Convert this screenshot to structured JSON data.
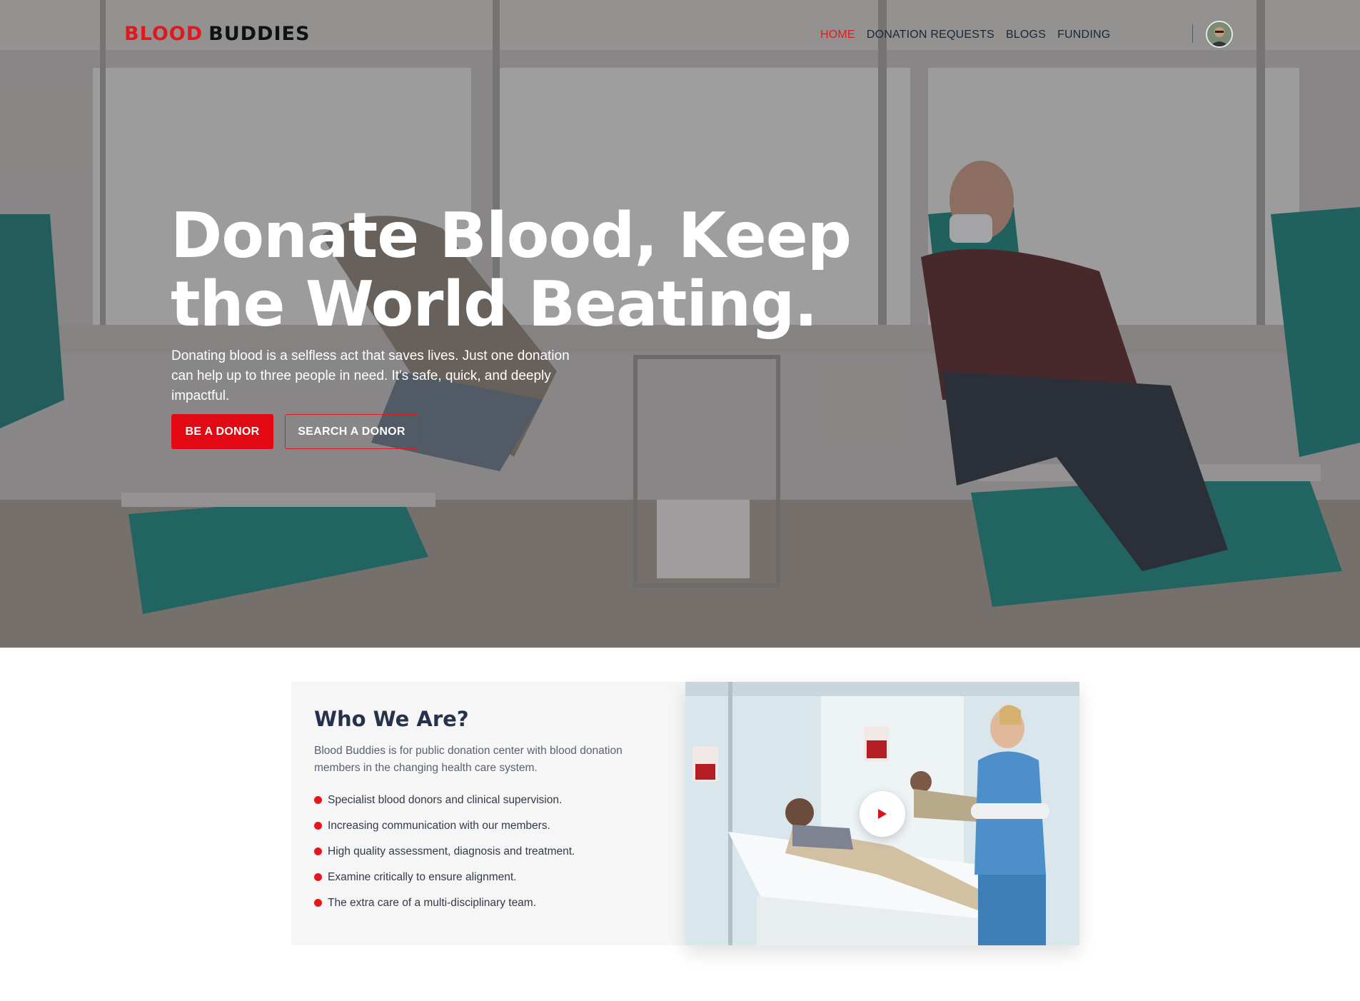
{
  "brand": {
    "part1": "BLOOD",
    "part2": "BUDDIES",
    "accent_color": "#e3181f"
  },
  "nav": {
    "items": [
      {
        "label": "HOME",
        "active": true
      },
      {
        "label": "DONATION REQUESTS",
        "active": false
      },
      {
        "label": "BLOGS",
        "active": false
      },
      {
        "label": "FUNDING",
        "active": false
      }
    ],
    "avatar_icon": "user-avatar-icon"
  },
  "hero": {
    "title_line1": "Donate Blood, Keep",
    "title_line2": "the World Beating.",
    "description": "Donating blood is a selfless act that saves lives. Just one donation can help up to three people in need. It's safe, quick, and deeply impactful.",
    "primary_button": "BE A DONOR",
    "secondary_button": "SEARCH A DONOR"
  },
  "about": {
    "title": "Who We Are?",
    "lead": "Blood Buddies is for public donation center with blood donation members in the changing health care system.",
    "points": [
      "Specialist blood donors and clinical supervision.",
      "Increasing communication with our members.",
      "High quality assessment, diagnosis and treatment.",
      "Examine critically to ensure alignment.",
      "The extra care of a multi-disciplinary team."
    ],
    "video_icon": "play-icon"
  }
}
